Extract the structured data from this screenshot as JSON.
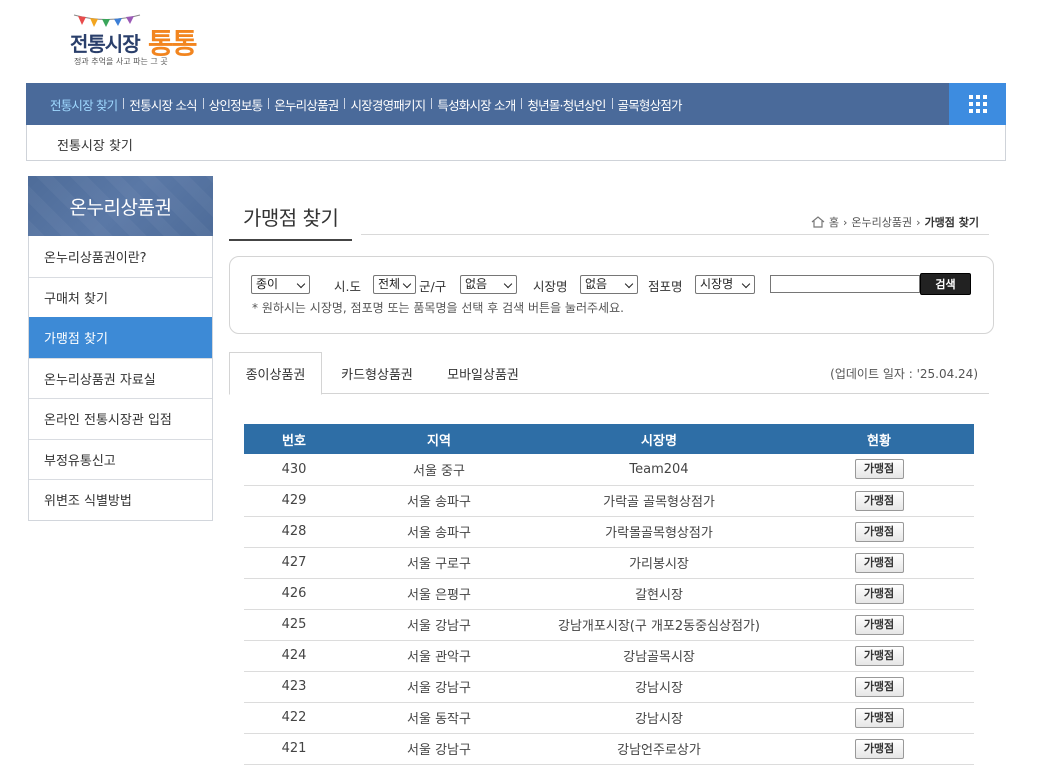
{
  "logo": {
    "main": "전통시장",
    "accent": "통통",
    "sub": "정과 추억을 사고 파는 그 곳"
  },
  "topnav": {
    "items": [
      "전통시장 찾기",
      "전통시장 소식",
      "상인정보통",
      "온누리상품권",
      "시장경영패키지",
      "특성화시장 소개",
      "청년몰·청년상인",
      "골목형상점가"
    ],
    "active_index": 0,
    "grid_icon": "grid-menu-icon"
  },
  "subbar": {
    "label": "전통시장 찾기"
  },
  "sidebar": {
    "title": "온누리상품권",
    "items": [
      "온누리상품권이란?",
      "구매처 찾기",
      "가맹점 찾기",
      "온누리상품권 자료실",
      "온라인 전통시장관 입점",
      "부정유통신고",
      "위변조 식별방법"
    ],
    "active_index": 2
  },
  "page": {
    "title": "가맹점 찾기",
    "breadcrumb": {
      "home": "홈",
      "section": "온누리상품권",
      "current": "가맹점 찾기"
    }
  },
  "search": {
    "type_value": "종이",
    "sido_label": "시.도",
    "sido_value": "전체",
    "gugun_label": "군/구",
    "gugun_value": "없음",
    "market_label": "시장명",
    "market_value": "없음",
    "store_label": "점포명",
    "store_value": "시장명",
    "text_value": "",
    "button": "검색",
    "hint": "* 원하시는 시장명, 점포명 또는 품목명을 선택 후 검색 버튼을 눌러주세요."
  },
  "tabs": {
    "items": [
      "종이상품권",
      "카드형상품권",
      "모바일상품권"
    ],
    "active_index": 0,
    "update": "(업데이트 일자 : '25.04.24)"
  },
  "table": {
    "headers": [
      "번호",
      "지역",
      "시장명",
      "현황"
    ],
    "button_label": "가맹점",
    "rows": [
      {
        "no": "430",
        "region": "서울 중구",
        "market": "Team204"
      },
      {
        "no": "429",
        "region": "서울 송파구",
        "market": "가락골 골목형상점가"
      },
      {
        "no": "428",
        "region": "서울 송파구",
        "market": "가락몰골목형상점가"
      },
      {
        "no": "427",
        "region": "서울 구로구",
        "market": "가리봉시장"
      },
      {
        "no": "426",
        "region": "서울 은평구",
        "market": "갈현시장"
      },
      {
        "no": "425",
        "region": "서울 강남구",
        "market": "강남개포시장(구 개포2동중심상점가)"
      },
      {
        "no": "424",
        "region": "서울 관악구",
        "market": "강남골목시장"
      },
      {
        "no": "423",
        "region": "서울 강남구",
        "market": "강남시장"
      },
      {
        "no": "422",
        "region": "서울 동작구",
        "market": "강남시장"
      },
      {
        "no": "421",
        "region": "서울 강남구",
        "market": "강남언주로상가"
      }
    ]
  }
}
